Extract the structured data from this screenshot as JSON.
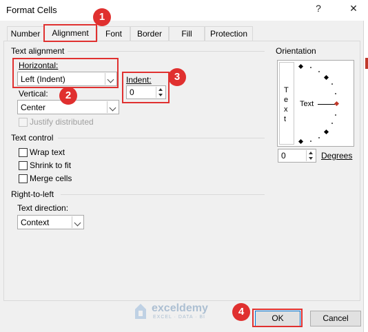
{
  "window": {
    "title": "Format Cells",
    "help_glyph": "?",
    "close_glyph": "✕"
  },
  "tabs": [
    {
      "label": "Number"
    },
    {
      "label": "Alignment"
    },
    {
      "label": "Font"
    },
    {
      "label": "Border"
    },
    {
      "label": "Fill"
    },
    {
      "label": "Protection"
    }
  ],
  "text_alignment": {
    "heading": "Text alignment",
    "horizontal_label": "Horizontal:",
    "horizontal_value": "Left (Indent)",
    "vertical_label": "Vertical:",
    "vertical_value": "Center",
    "indent_label": "Indent:",
    "indent_value": "0",
    "justify_label": "Justify distributed"
  },
  "text_control": {
    "heading": "Text control",
    "wrap_label": "Wrap text",
    "shrink_label": "Shrink to fit",
    "merge_label": "Merge cells"
  },
  "rtl": {
    "heading": "Right-to-left",
    "direction_label": "Text direction:",
    "direction_value": "Context"
  },
  "orientation": {
    "heading": "Orientation",
    "vertical_letters": [
      "T",
      "e",
      "x",
      "t"
    ],
    "text_label": "Text",
    "degrees_value": "0",
    "degrees_label": "Degrees"
  },
  "buttons": {
    "ok": "OK",
    "cancel": "Cancel"
  },
  "callouts": [
    "1",
    "2",
    "3",
    "4"
  ],
  "watermark": {
    "name": "exceldemy",
    "tagline": "EXCEL · DATA · BI"
  },
  "colors": {
    "callout_red": "#e0302f",
    "dialog_bg": "#f0f0f0",
    "focus_blue": "#0078d7"
  }
}
